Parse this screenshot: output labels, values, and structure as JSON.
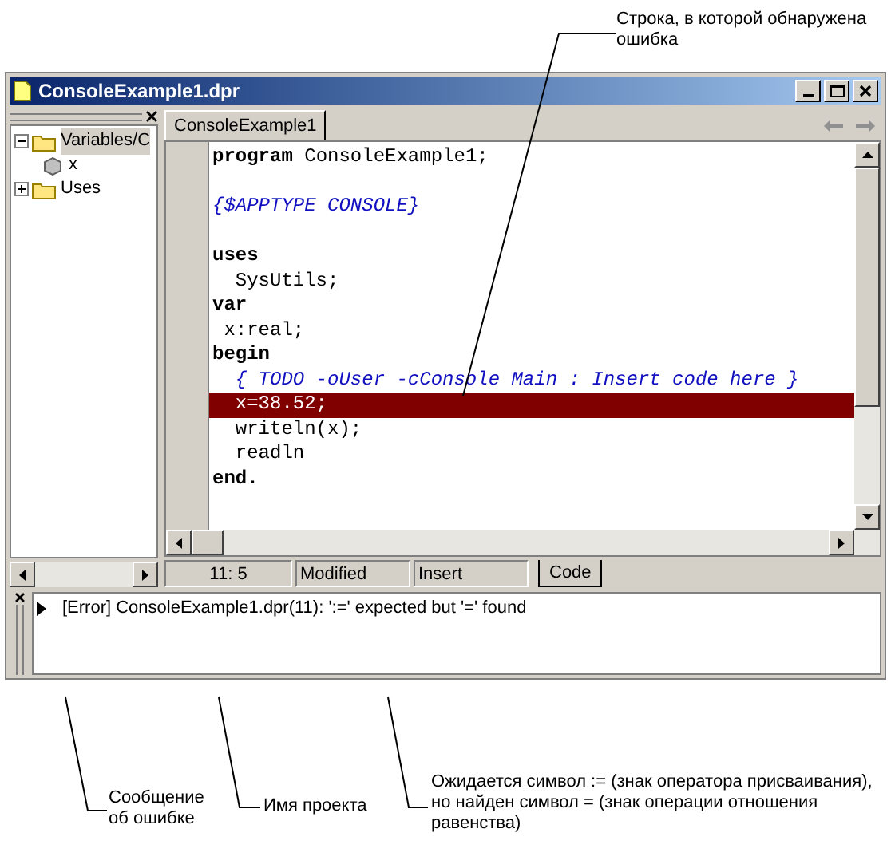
{
  "callouts": [
    {
      "text": "Строка, в которой обнаружена ошибка"
    },
    {
      "text": "Сообщение об ошибке"
    },
    {
      "text": "Имя проекта"
    },
    {
      "text": "Ожидается символ := (знак оператора присваивания), но найден символ = (знак операции отношения равенства)"
    }
  ],
  "window": {
    "title": "ConsoleExample1.dpr"
  },
  "tree": [
    {
      "label": "Variables/C",
      "expanded": true,
      "selected": true,
      "children": [
        {
          "label": "x",
          "selected": false
        }
      ]
    },
    {
      "label": "Uses",
      "expanded": false,
      "selected": false
    }
  ],
  "editor_tabs": [
    {
      "label": "ConsoleExample1",
      "selected": true
    }
  ],
  "code_lines": [
    {
      "kind": "code",
      "text": "**program** ConsoleExample1;",
      "error": false
    },
    {
      "kind": "blank"
    },
    {
      "kind": "directive",
      "text": "{$APPTYPE CONSOLE}",
      "error": false
    },
    {
      "kind": "blank"
    },
    {
      "kind": "code",
      "text": "**uses**",
      "error": false
    },
    {
      "kind": "code",
      "text": "  SysUtils;",
      "error": false
    },
    {
      "kind": "code",
      "text": "**var**",
      "error": false
    },
    {
      "kind": "code",
      "text": " x:real;",
      "error": false
    },
    {
      "kind": "code",
      "text": "**begin**",
      "error": false
    },
    {
      "kind": "directive",
      "text": "  { TODO -oUser -cConsole Main : Insert code here }",
      "error": false
    },
    {
      "kind": "code",
      "text": "  x=38.52;",
      "error": true
    },
    {
      "kind": "code",
      "text": "  writeln(x);",
      "error": false
    },
    {
      "kind": "code",
      "text": "  readln",
      "error": false
    },
    {
      "kind": "code",
      "text": "**end.**",
      "error": false
    }
  ],
  "status_bar": {
    "position": "11:  5",
    "modified": "Modified",
    "mode": "Insert",
    "view_tabs": [
      {
        "label": "Code",
        "selected": true
      }
    ]
  },
  "messages": [
    {
      "text": "[Error] ConsoleExample1.dpr(11): ':=' expected but '=' found"
    }
  ]
}
